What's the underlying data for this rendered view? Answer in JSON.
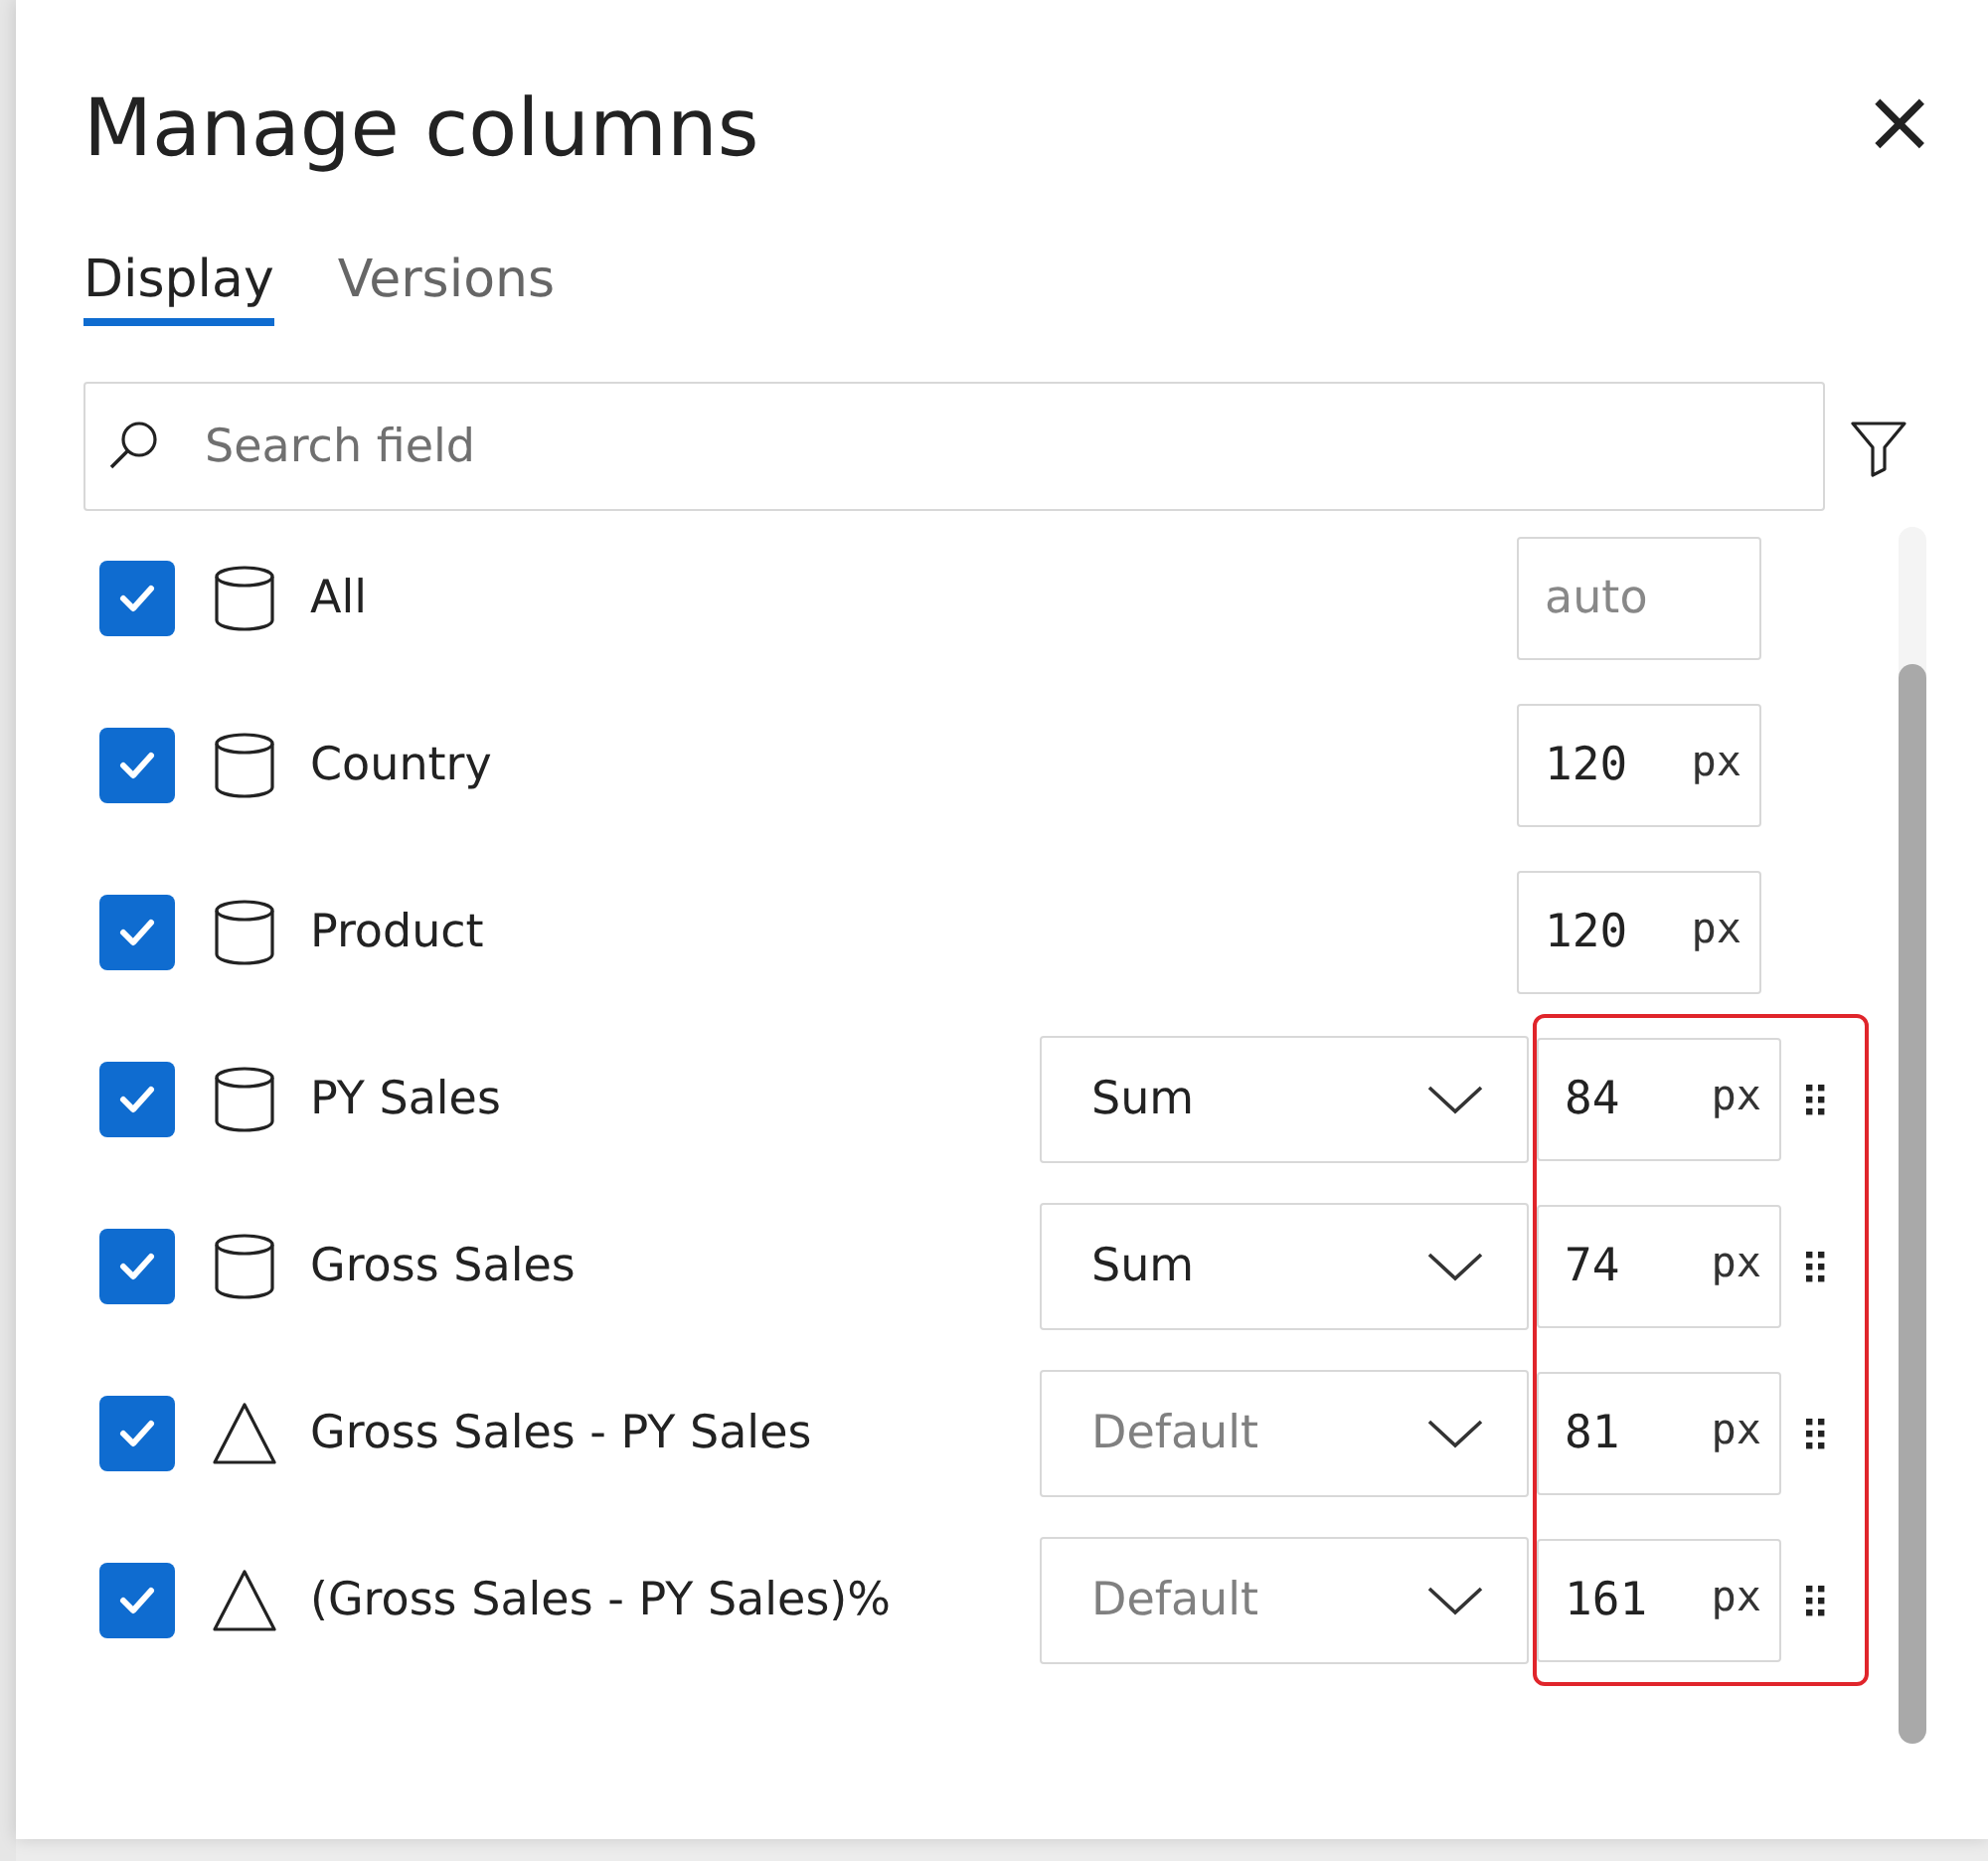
{
  "dialog": {
    "title": "Manage columns",
    "close_label": "×"
  },
  "tabs": [
    {
      "label": "Display",
      "selected": true
    },
    {
      "label": "Versions",
      "selected": false
    }
  ],
  "search": {
    "placeholder": "Search field"
  },
  "columns": [
    {
      "kind": "measure",
      "name": "All",
      "checked": true,
      "width": {
        "placeholder": "auto"
      },
      "draggable": false,
      "highlighted": false
    },
    {
      "kind": "measure",
      "name": "Country",
      "checked": true,
      "width": {
        "value": "120",
        "unit": "px"
      },
      "draggable": false,
      "highlighted": false
    },
    {
      "kind": "measure",
      "name": "Product",
      "checked": true,
      "width": {
        "value": "120",
        "unit": "px"
      },
      "draggable": false,
      "highlighted": false
    },
    {
      "kind": "measure",
      "name": "PY Sales",
      "checked": true,
      "aggregation": {
        "value": "Sum",
        "disabled": false
      },
      "width": {
        "value": "84",
        "unit": "px"
      },
      "draggable": true,
      "highlighted": true
    },
    {
      "kind": "measure",
      "name": "Gross Sales",
      "checked": true,
      "aggregation": {
        "value": "Sum",
        "disabled": false
      },
      "width": {
        "value": "74",
        "unit": "px"
      },
      "draggable": true,
      "highlighted": true
    },
    {
      "kind": "calculated",
      "name": "Gross Sales - PY Sales",
      "checked": true,
      "aggregation": {
        "value": "Default",
        "disabled": true
      },
      "width": {
        "value": "81",
        "unit": "px"
      },
      "draggable": true,
      "highlighted": true
    },
    {
      "kind": "calculated",
      "name": "(Gross Sales - PY Sales)%",
      "checked": true,
      "aggregation": {
        "value": "Default",
        "disabled": true
      },
      "width": {
        "value": "161",
        "unit": "px"
      },
      "draggable": true,
      "highlighted": true
    }
  ]
}
